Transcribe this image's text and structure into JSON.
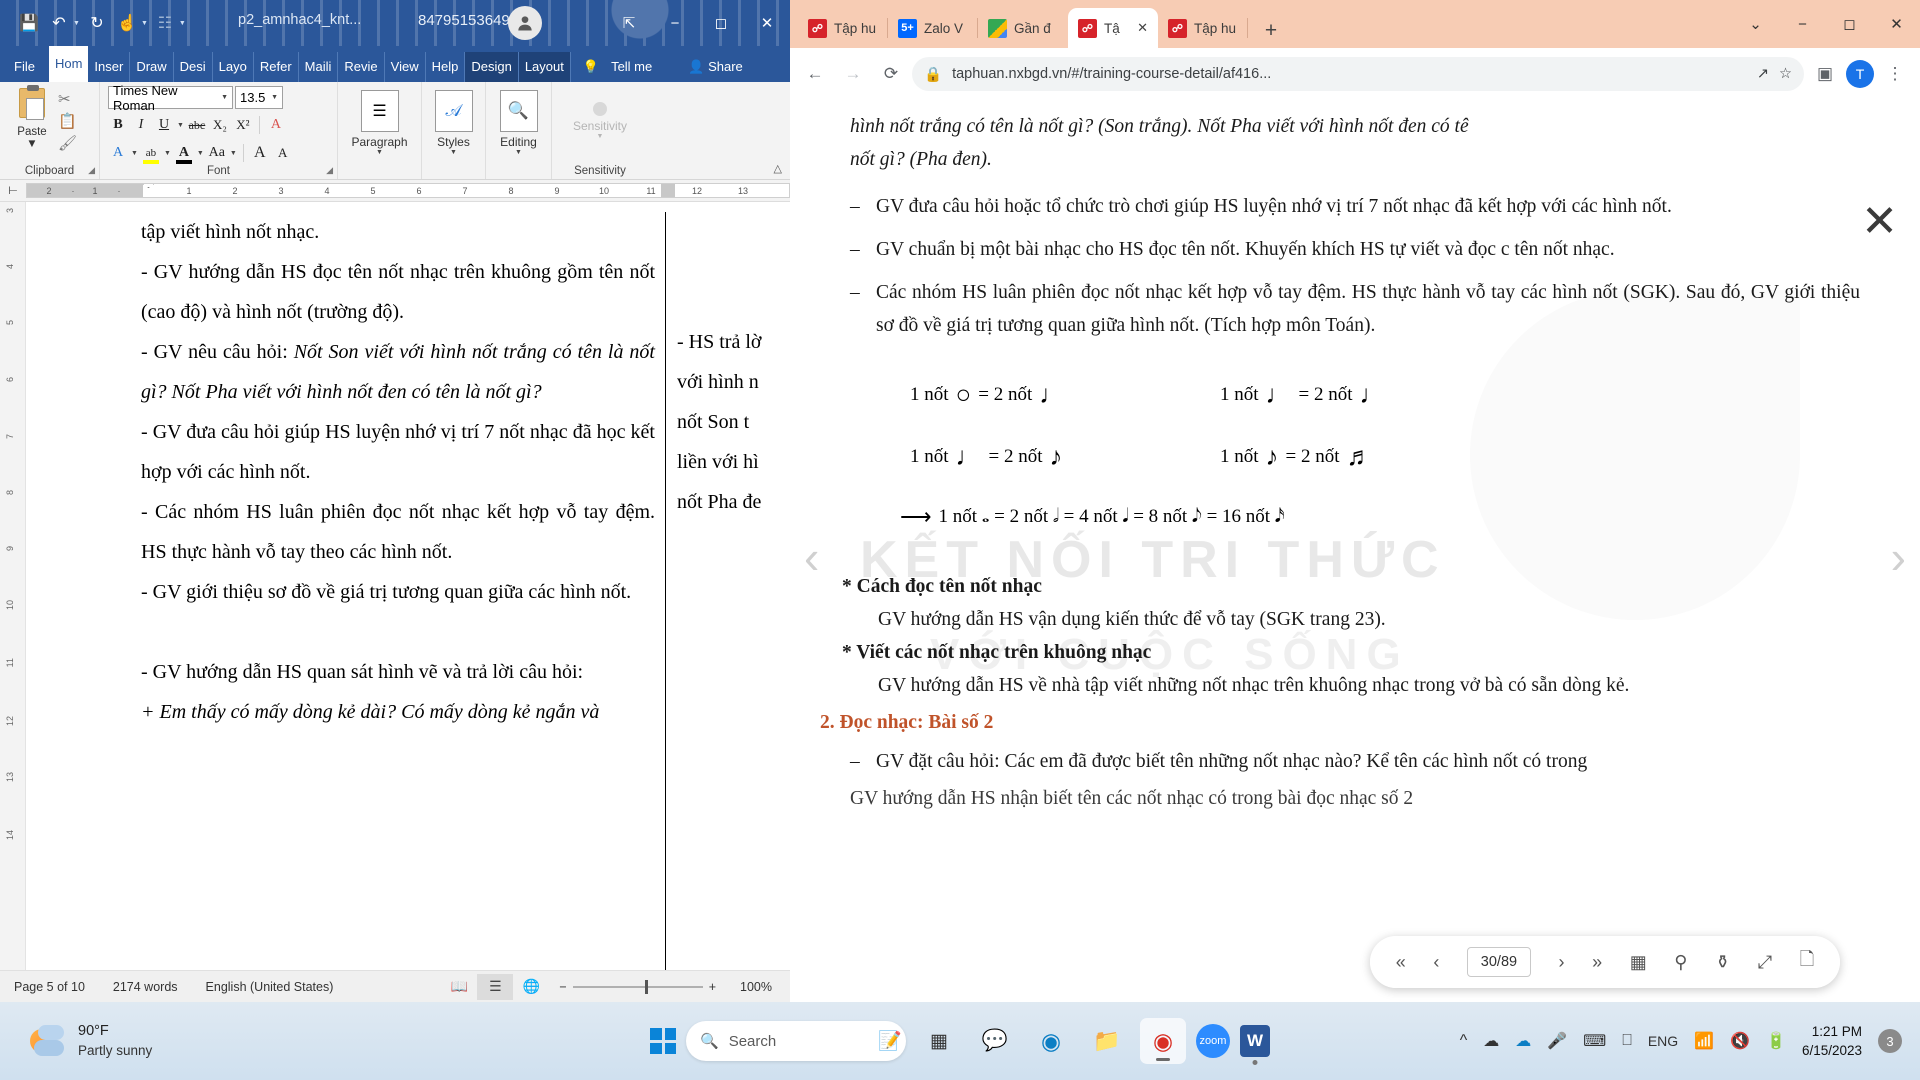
{
  "word": {
    "title_bar": {
      "doc_name": "p2_amnhac4_knt...",
      "phone": "84795153649",
      "qat": [
        "save-icon",
        "undo-icon",
        "redo-icon",
        "touch-mode-icon",
        "customize-icon",
        "more-icon"
      ],
      "window_controls": [
        "ribbon-display-icon",
        "minimize",
        "maximize",
        "close"
      ]
    },
    "tabs": [
      {
        "label": "File",
        "state": "file"
      },
      {
        "label": "Hom",
        "state": "active"
      },
      {
        "label": "Inser",
        "state": "normal"
      },
      {
        "label": "Draw",
        "state": "normal"
      },
      {
        "label": "Desi",
        "state": "normal"
      },
      {
        "label": "Layo",
        "state": "normal"
      },
      {
        "label": "Refer",
        "state": "normal"
      },
      {
        "label": "Maili",
        "state": "normal"
      },
      {
        "label": "Revie",
        "state": "normal"
      },
      {
        "label": "View",
        "state": "normal"
      },
      {
        "label": "Help",
        "state": "normal"
      },
      {
        "label": "Design",
        "state": "context"
      },
      {
        "label": "Layout",
        "state": "context"
      }
    ],
    "tell_me": "Tell me",
    "share": "Share",
    "ribbon": {
      "clipboard": {
        "group": "Clipboard",
        "paste": "Paste",
        "cut": "cut-icon",
        "copy": "copy-icon",
        "format_painter": "format-painter-icon"
      },
      "font": {
        "group": "Font",
        "font_name": "Times New Roman",
        "font_size": "13.5",
        "bold": "B",
        "italic": "I",
        "underline": "U",
        "strike": "abc",
        "subscript": "X₂",
        "superscript": "X²",
        "clear_format": "A",
        "text_effects": "A",
        "highlight": "ab",
        "font_color": "A",
        "change_case": "Aa",
        "grow": "A",
        "shrink": "A",
        "highlight_color": "#ffff00",
        "font_color_value": "#000000"
      },
      "paragraph": {
        "group": "Paragraph",
        "label": "Paragraph"
      },
      "styles": {
        "label": "Styles"
      },
      "editing": {
        "label": "Editing"
      },
      "sensitivity": {
        "group": "Sensitivity",
        "label": "Sensitivity"
      }
    },
    "ruler": {
      "left_marks": [
        "2",
        "1"
      ],
      "marks": [
        "1",
        "2",
        "3",
        "4",
        "5",
        "6",
        "7",
        "8",
        "9",
        "10",
        "11",
        "12",
        "13"
      ],
      "vertical_marks": [
        "3",
        "4",
        "5",
        "6",
        "7",
        "8",
        "9",
        "10",
        "11",
        "12",
        "13",
        "14"
      ]
    },
    "document": {
      "col1": [
        {
          "text": "tập viết hình nốt nhạc.",
          "style": "normal"
        },
        {
          "text": "- GV hướng dẫn HS đọc tên nốt nhạc trên khuông gồm tên nốt (cao độ) và hình nốt (trường độ).",
          "style": "normal"
        },
        {
          "text": "- GV nêu câu hỏi: ",
          "style": "normal",
          "italic_tail": "Nốt Son viết với hình nốt trắng có tên là nốt gì? Nốt Pha viết với hình nốt đen có tên là nốt gì?"
        },
        {
          "text": "- GV đưa câu hỏi giúp HS luyện nhớ vị trí 7 nốt nhạc đã học kết hợp với các hình nốt.",
          "style": "normal"
        },
        {
          "text": "- Các nhóm HS luân phiên đọc nốt nhạc kết hợp vỗ tay đệm. HS thực hành vỗ tay theo các hình nốt.",
          "style": "normal"
        },
        {
          "text": "- GV giới thiệu sơ đồ về giá trị tương quan giữa các hình nốt.",
          "style": "normal"
        },
        {
          "text": "",
          "style": "blank"
        },
        {
          "text": "- GV hướng dẫn HS quan sát hình vẽ và trả lời câu hỏi:",
          "style": "normal"
        },
        {
          "text": "+ Em thấy có mấy dòng kẻ dài? Có mấy dòng kẻ ngắn và",
          "style": "italic"
        }
      ],
      "col2": [
        "- HS trả lờ",
        "với  hình  n",
        "nốt  Son  t",
        "liền với hì",
        "nốt Pha đe"
      ]
    },
    "status_bar": {
      "page": "Page 5 of 10",
      "words": "2174 words",
      "language": "English (United States)",
      "views": [
        "read-mode-icon",
        "print-layout-icon",
        "web-layout-icon"
      ],
      "zoom_out": "−",
      "zoom_in": "+",
      "zoom_level": "100%"
    }
  },
  "chrome": {
    "tabs": [
      {
        "label": "Tập hu",
        "favicon": "nxbgd-icon",
        "active": false
      },
      {
        "label": "Zalo V",
        "favicon": "zalo-icon",
        "active": false
      },
      {
        "label": "Gần đ",
        "favicon": "drive-icon",
        "active": false
      },
      {
        "label": "Tậ",
        "favicon": "nxbgd-icon",
        "active": true
      },
      {
        "label": "Tập hu",
        "favicon": "nxbgd-icon",
        "active": false
      }
    ],
    "new_tab": "+",
    "window_controls": [
      "chevron-down",
      "minimize",
      "maximize",
      "close"
    ],
    "toolbar": {
      "back": "back-icon",
      "forward": "forward-icon",
      "reload": "reload-icon",
      "lock": "lock-icon",
      "url": "taphuan.nxbgd.vn/#/training-course-detail/af416...",
      "share": "share-icon",
      "bookmark": "star-icon",
      "sidepanel": "side-panel-icon",
      "profile": "T",
      "menu": "three-dot-menu-icon"
    },
    "pdf": {
      "close_overlay": "close-icon",
      "prev_page": "chevron-left-icon",
      "next_page": "chevron-right-icon",
      "content": {
        "line_top_italic": "hình nốt trắng có tên là nốt gì? (Son trắng). Nốt Pha viết với hình nốt đen có tê",
        "line_top2_italic": "nốt gì? (Pha đen).",
        "bullets": [
          "GV đưa câu hỏi hoặc tổ chức trò chơi giúp HS luyện nhớ vị trí 7 nốt nhạc đã kết hợp với các hình nốt.",
          "GV chuẩn bị một bài nhạc cho HS đọc tên nốt. Khuyến khích HS tự viết và đọc c tên nốt nhạc.",
          "Các nhóm HS luân phiên đọc nốt nhạc kết hợp vỗ tay đệm. HS thực hành vỗ tay các hình nốt (SGK). Sau đó, GV giới thiệu sơ đồ về giá trị tương quan giữa hình nốt. (Tích hợp môn Toán)."
        ],
        "note_rows": [
          [
            {
              "l": "1 nốt",
              "n1": "whole",
              "eq": "= 2 nốt",
              "n2": "half"
            },
            {
              "l": "1 nốt",
              "n1": "half",
              "eq": "= 2 nốt",
              "n2": "quarter"
            }
          ],
          [
            {
              "l": "1 nốt",
              "n1": "quarter",
              "eq": "= 2 nốt",
              "n2": "eighth"
            },
            {
              "l": "1 nốt",
              "n1": "eighth",
              "eq": "= 2 nốt",
              "n2": "sixteenth"
            }
          ]
        ],
        "summary_row": "1 nốt  𝅝 = 2 nốt 𝅗𝅥 = 4 nốt 𝅘𝅥 = 8 nốt 𝅘𝅥𝅮 = 16 nốt 𝅘𝅥𝅯",
        "heading1": "* Cách đọc tên nốt nhạc",
        "para1": "GV hướng dẫn HS vận dụng kiến thức để vỗ tay (SGK trang 23).",
        "heading2": "* Viết các nốt nhạc trên khuông nhạc",
        "para2": "GV hướng dẫn HS về nhà tập viết những nốt nhạc trên khuông nhạc trong vở bà có sẵn dòng kẻ.",
        "heading3": "2. Đọc nhạc: Bài số 2",
        "bullet_last": "GV đặt câu hỏi: Các em đã được biết tên những nốt nhạc nào? Kể tên các hình nốt có trong",
        "line_cut": "GV hướng dẫn HS nhận biết tên các nốt nhạc có trong bài đọc nhạc số 2",
        "watermark": "KẾT NỐI TRI THỨC",
        "watermark2": "VỚI CUỘC SỐNG"
      },
      "toolbar": {
        "first": "first-page-icon",
        "prev": "previous-page-icon",
        "page_indicator": "30/89",
        "next": "next-page-icon",
        "last": "last-page-icon",
        "thumbnails": "thumbnail-view-icon",
        "zoom_in": "zoom-in-icon",
        "zoom_out": "zoom-out-icon",
        "fit": "fit-page-icon",
        "page_mode": "single-page-icon"
      }
    }
  },
  "taskbar": {
    "weather": {
      "temp": "90°F",
      "condition": "Partly sunny"
    },
    "start": "windows-start-icon",
    "search_placeholder": "Search",
    "apps": [
      {
        "name": "task-view-icon"
      },
      {
        "name": "teams-icon"
      },
      {
        "name": "edge-icon"
      },
      {
        "name": "file-explorer-icon"
      },
      {
        "name": "chrome-icon",
        "active": true
      },
      {
        "name": "zoom-icon",
        "label": "zoom"
      },
      {
        "name": "word-icon",
        "label": "W"
      }
    ],
    "tray": {
      "chevron": "show-hidden-icons",
      "onedrive": "onedrive-icon",
      "cloud": "cloud-icon",
      "mic": "microphone-icon",
      "keyboard": "keyboard-icon",
      "touchpad": "touchpad-icon",
      "language": "ENG",
      "wifi": "wifi-icon",
      "volume": "volume-muted-icon",
      "battery": "battery-icon",
      "time": "1:21 PM",
      "date": "6/15/2023",
      "notifications": "3"
    }
  },
  "colors": {
    "word_accent": "#2b579a",
    "chrome_tabstrip": "#f7ccb4",
    "taskbar": "#dfe9f2",
    "highlight_yellow": "#ffff00"
  }
}
